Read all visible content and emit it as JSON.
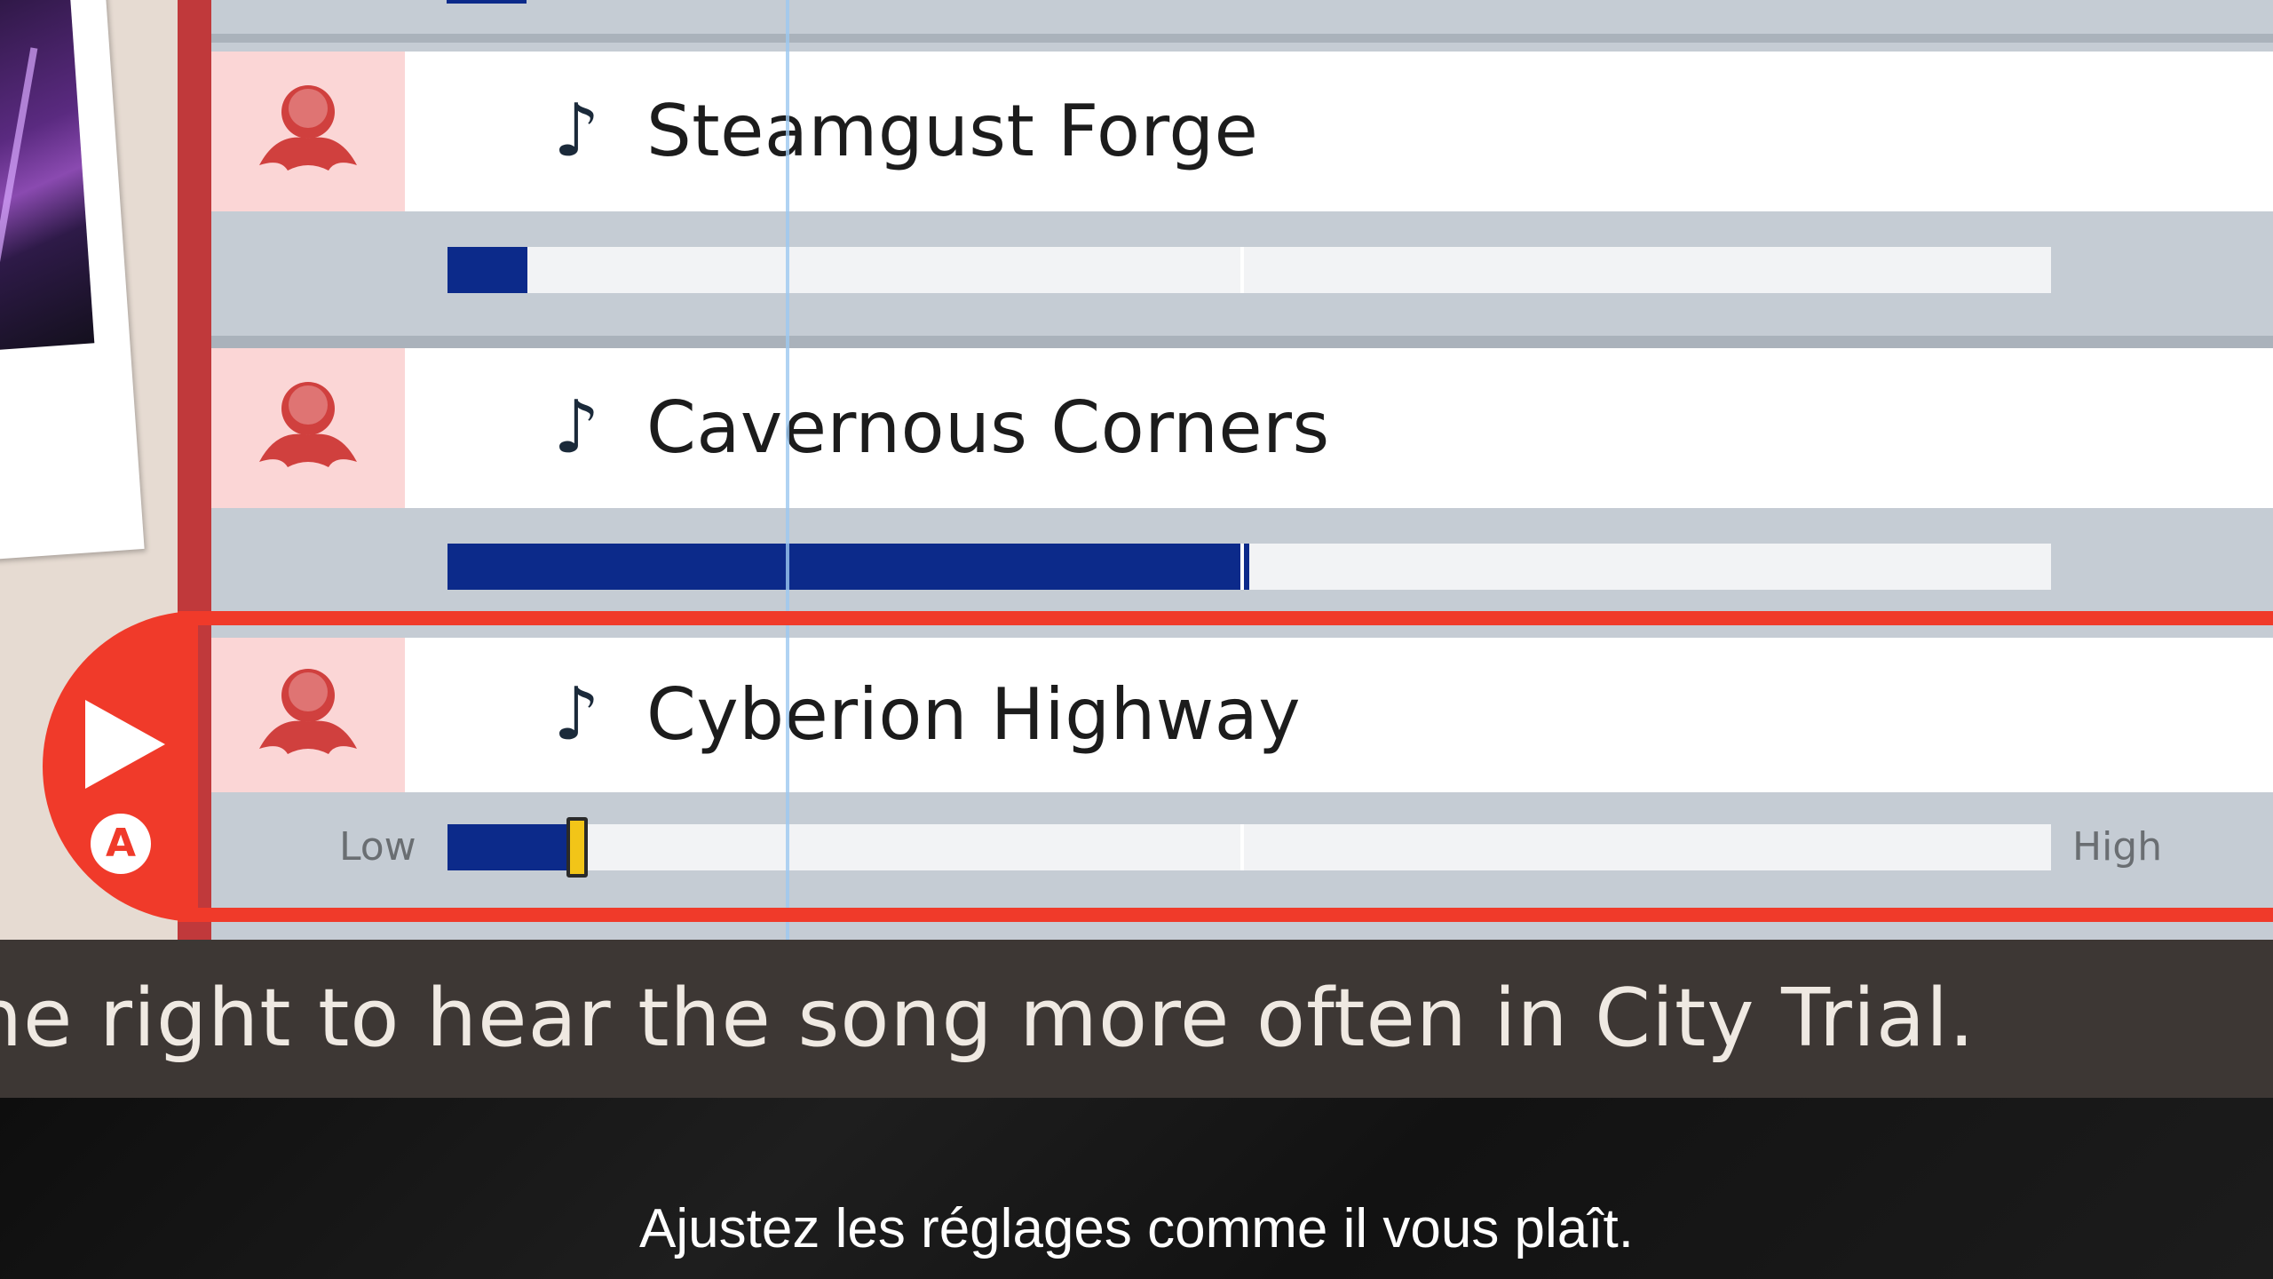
{
  "songs": [
    {
      "title": "Steamgust Forge",
      "level": 0.05,
      "selected": false
    },
    {
      "title": "Cavernous Corners",
      "level": 0.5,
      "selected": false
    },
    {
      "title": "Cyberion Highway",
      "level": 0.08,
      "selected": true
    }
  ],
  "slider": {
    "low_label": "Low",
    "high_label": "High"
  },
  "play_button": {
    "button_glyph": "A"
  },
  "instruction": "he right to hear the song more often in City Trial.",
  "subtitle": "Ajustez les réglages comme il vous plaît.",
  "colors": {
    "accent_red": "#f03a2a",
    "rail_red": "#c0393b",
    "bar_fill": "#0c2a8a",
    "knob_yellow": "#f2c518",
    "icon_bg": "#fbd6d6",
    "icon_color": "#d0403e"
  },
  "icons": {
    "row_icon": "character-silhouette-icon",
    "note_icon": "music-note-icon",
    "play_icon": "play-icon"
  }
}
